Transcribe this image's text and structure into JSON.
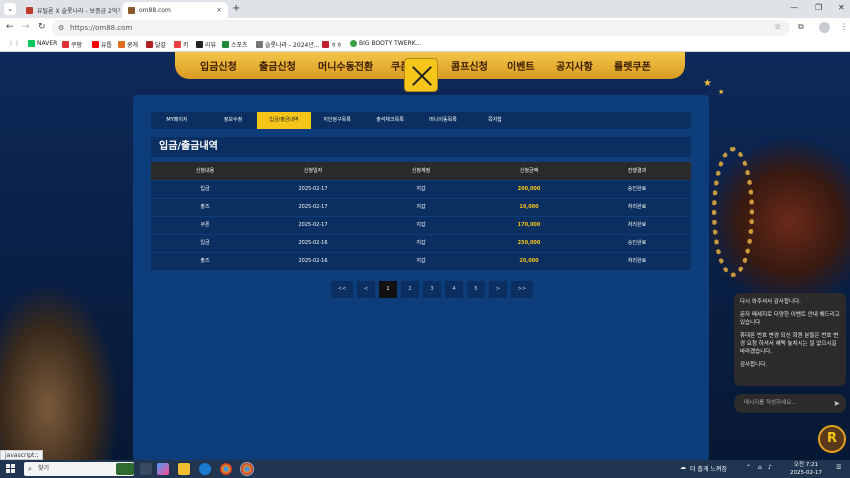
{
  "browser": {
    "tabs": [
      {
        "title": "유틸론 X 슬롯나라 - 보증금 2억"
      },
      {
        "title": "om88.com"
      }
    ],
    "new_tab": "+",
    "url": "https://om88.com",
    "bookmarks": [
      "NAVER",
      "쿠팡",
      "유툽",
      "쿵게",
      "달갈",
      "키",
      "리뷰",
      "스포츠",
      "슬롯나라 - 2024년...",
      "ㅎㅎ",
      "BIG BOOTY TWERK..."
    ],
    "status_text": "javascript:;"
  },
  "site": {
    "menu": [
      "입금신청",
      "출금신청",
      "머니수동전환",
      "쿠폰",
      "콤프신청",
      "이벤트",
      "공지사항",
      "룰렛쿠폰"
    ],
    "subtabs": [
      {
        "label": "MY페이지",
        "active": false
      },
      {
        "label": "정보수정",
        "active": false
      },
      {
        "label": "입금/출금내역",
        "active": true
      },
      {
        "label": "지인정구목록",
        "active": false
      },
      {
        "label": "출석체크목록",
        "active": false
      },
      {
        "label": "머니이동목록",
        "active": false
      },
      {
        "label": "쪽지함",
        "active": false
      }
    ],
    "section_title": "입금/출금내역",
    "table": {
      "headers": [
        "신청내용",
        "신청일자",
        "신청계정",
        "신청금액",
        "진행결과"
      ],
      "rows": [
        [
          "입금",
          "2025-02-17",
          "지갑",
          "200,000",
          "승인완료"
        ],
        [
          "출즈",
          "2025-02-17",
          "지갑",
          "10,000",
          "처리완료"
        ],
        [
          "쿠폰",
          "2025-02-17",
          "지갑",
          "170,000",
          "처리완료"
        ],
        [
          "입금",
          "2025-02-16",
          "지갑",
          "250,000",
          "승인완료"
        ],
        [
          "출즈",
          "2025-02-16",
          "지갑",
          "20,000",
          "처리완료"
        ]
      ]
    },
    "pager": {
      "first": "<<",
      "prev": "<",
      "pages": [
        "1",
        "2",
        "3",
        "4",
        "5"
      ],
      "current": "1",
      "next": ">",
      "last": ">>"
    }
  },
  "chat": {
    "messages": [
      "다시 와주셔서 감사합니다.",
      "문자 메세지로 다양한 이벤트 안내 해드리고 있습니다",
      "휴대폰 번호 변경 되신 회원 분들은 번호 변경 요청 하셔서 혜택 놓치시는 일 없으시길 바라겠습니다.",
      "감사합니다."
    ],
    "input_placeholder": "메시지를 작성하세요...",
    "logo_letter": "R"
  },
  "taskbar": {
    "search_placeholder": "찾기",
    "tray_text": "더 춥게 느껴짐",
    "time": "오전 7:21",
    "date": "2025-02-17"
  }
}
